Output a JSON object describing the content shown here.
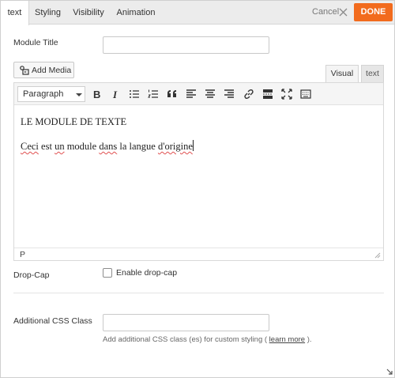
{
  "tabs": [
    {
      "label": "text"
    },
    {
      "label": "Styling"
    },
    {
      "label": "Visibility"
    },
    {
      "label": "Animation"
    }
  ],
  "header": {
    "cancel_label": "Cancel",
    "done_label": "DONE"
  },
  "module_title": {
    "label": "Module Title",
    "value": ""
  },
  "editor": {
    "add_media_label": "Add Media",
    "view_tabs": [
      {
        "label": "Visual"
      },
      {
        "label": "text"
      }
    ],
    "format_select": "Paragraph",
    "toolbar_icons": [
      "bold-icon",
      "italic-icon",
      "bullet-list-icon",
      "numbered-list-icon",
      "blockquote-icon",
      "align-left-icon",
      "align-center-icon",
      "align-right-icon",
      "link-icon",
      "read-more-icon",
      "fullscreen-icon",
      "kitchen-sink-icon"
    ],
    "content": {
      "heading": "LE MODULE DE TEXTE",
      "paragraph": {
        "w1": "Ceci",
        "s1": " est ",
        "w2": "un",
        "s2": " module ",
        "w3": "dans",
        "s3": " la langue ",
        "w4": "d'origine"
      }
    },
    "status_path": "P"
  },
  "drop_cap": {
    "label": "Drop-Cap",
    "checkbox_label": "Enable drop-cap",
    "checked": false
  },
  "css_class": {
    "label": "Additional CSS Class",
    "value": "",
    "help_before": "Add additional CSS class (es) for custom styling (",
    "help_link": "learn more",
    "help_after": ")."
  },
  "colors": {
    "accent": "#f26b1d",
    "spellcheck": "#e05050"
  }
}
